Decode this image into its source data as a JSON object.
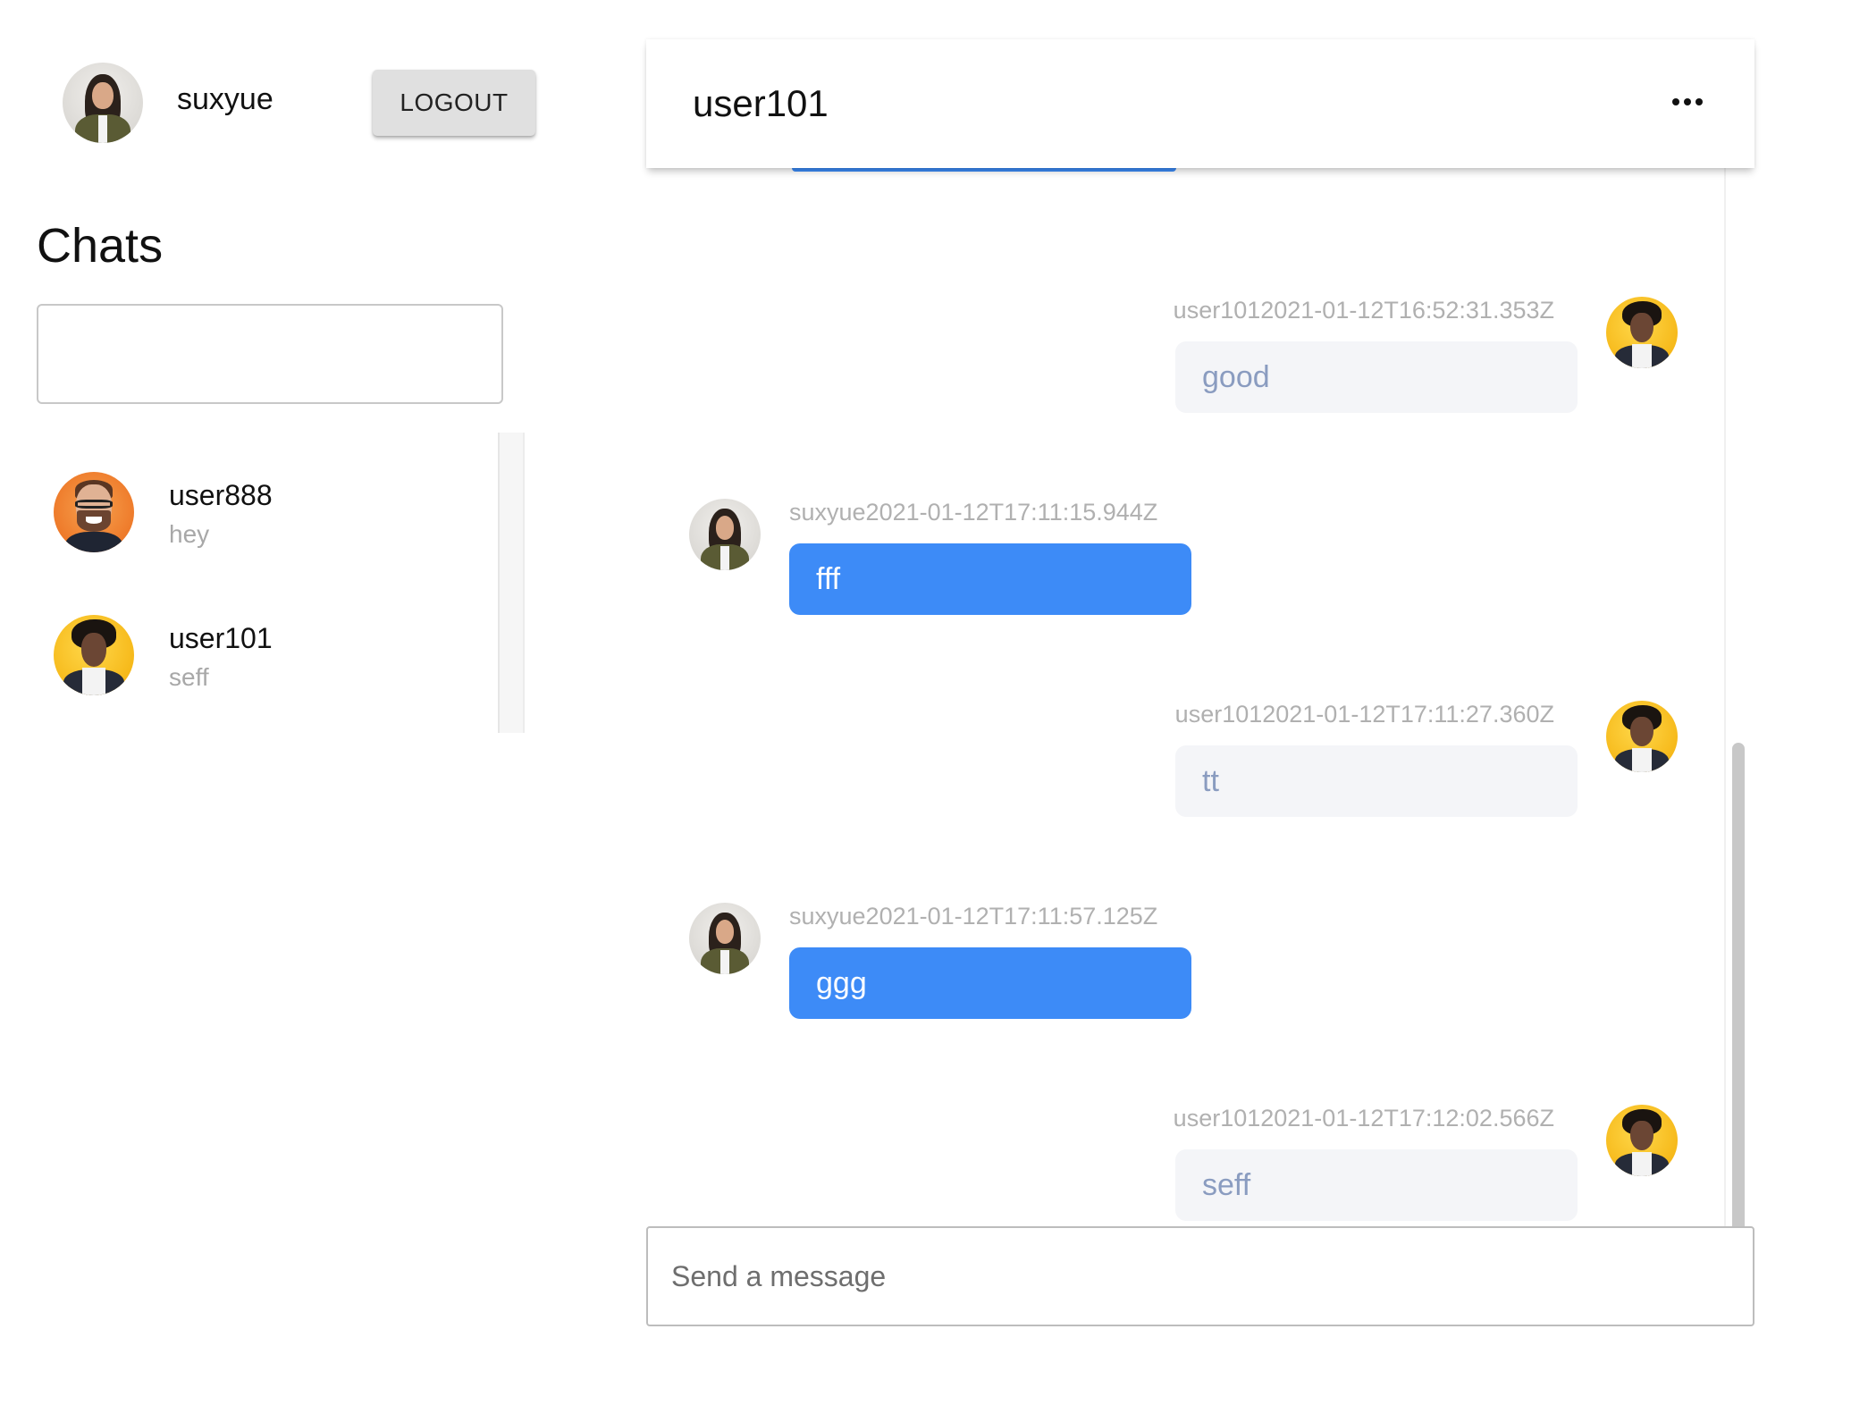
{
  "profile": {
    "username": "suxyue",
    "avatar_icon": "user-avatar-woman",
    "logout_label": "LOGOUT"
  },
  "sidebar": {
    "title": "Chats",
    "search": {
      "value": "",
      "placeholder": ""
    },
    "chats": [
      {
        "name": "user888",
        "preview": "hey",
        "avatar_icon": "user-avatar-orange"
      },
      {
        "name": "user101",
        "preview": "seff",
        "avatar_icon": "user-avatar-yellow"
      }
    ]
  },
  "chat": {
    "title": "user101",
    "menu_icon": "more-horizontal-icon",
    "messages": [
      {
        "sender": "user101",
        "timestamp": "2021-01-12T16:52:31.353Z",
        "meta": "user1012021-01-12T16:52:31.353Z",
        "text": "good",
        "mine": false
      },
      {
        "sender": "suxyue",
        "timestamp": "2021-01-12T17:11:15.944Z",
        "meta": "suxyue2021-01-12T17:11:15.944Z",
        "text": "fff",
        "mine": true
      },
      {
        "sender": "user101",
        "timestamp": "2021-01-12T17:11:27.360Z",
        "meta": "user1012021-01-12T17:11:27.360Z",
        "text": "tt",
        "mine": false
      },
      {
        "sender": "suxyue",
        "timestamp": "2021-01-12T17:11:57.125Z",
        "meta": "suxyue2021-01-12T17:11:57.125Z",
        "text": "ggg",
        "mine": true
      },
      {
        "sender": "user101",
        "timestamp": "2021-01-12T17:12:02.566Z",
        "meta": "user1012021-01-12T17:12:02.566Z",
        "text": "seff",
        "mine": false
      }
    ],
    "composer": {
      "value": "",
      "placeholder": "Send a message"
    }
  },
  "colors": {
    "accent": "#3d8bf7",
    "incoming_bubble": "#f4f5f8",
    "incoming_text": "#8a9cc0",
    "meta_text": "#b0b0b0",
    "preview_text": "#a8a8a8",
    "logout_bg": "#e0e0e0"
  }
}
